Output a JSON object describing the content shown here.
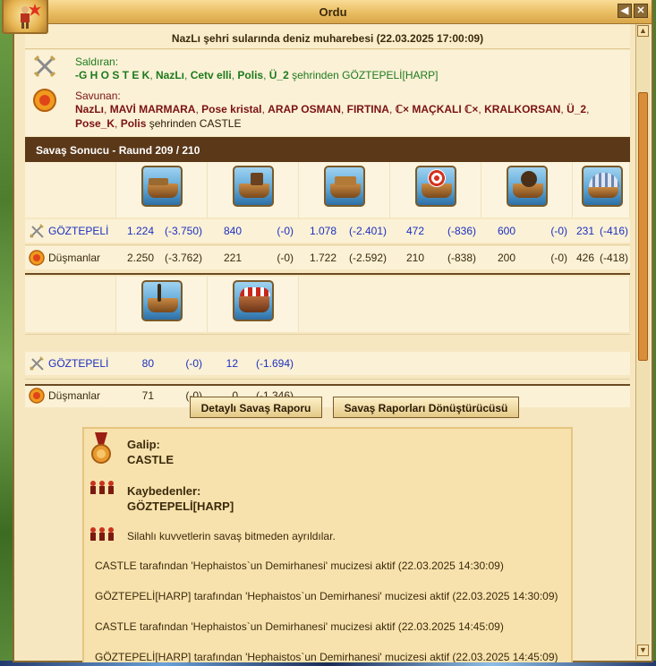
{
  "window": {
    "title": "Ordu"
  },
  "report": {
    "title": "NazLı şehri sularında deniz muharebesi (22.03.2025 17:00:09)"
  },
  "attacker": {
    "label": "Saldıran:",
    "names": [
      "-G H O S T E K",
      "NazLı",
      "Cetv elli",
      "Polis",
      "Ü_2"
    ],
    "from_text": "şehrinden GÖZTEPELİ[HARP]"
  },
  "defender": {
    "label": "Savunan:",
    "names": [
      "NazLı",
      "MAVİ MARMARA",
      "Pose kristal",
      "ARAP OSMAN",
      "FIRTINA",
      "ℂ× MAÇKALI ℂ×",
      "KRALKORSAN",
      "Ü_2",
      "Pose_K",
      "Polis"
    ],
    "from_text": "şehrinden CASTLE"
  },
  "result_bar": "Savaş Sonucu - Raund 209 / 210",
  "rows": {
    "ally_name": "GÖZTEPELİ",
    "enemy_name": "Düşmanlar"
  },
  "units_row1": [
    {
      "icon": "ram-ship-icon",
      "ally": "1.224",
      "ally_loss": "(-3.750)",
      "enemy": "2.250",
      "enemy_loss": "(-3.762)"
    },
    {
      "icon": "fire-ship-icon",
      "ally": "840",
      "ally_loss": "(-0)",
      "enemy": "221",
      "enemy_loss": "(-0)"
    },
    {
      "icon": "ballista-ship-icon",
      "ally": "1.078",
      "ally_loss": "(-2.401)",
      "enemy": "1.722",
      "enemy_loss": "(-2.592)"
    },
    {
      "icon": "catapult-ship-icon",
      "ally": "472",
      "ally_loss": "(-836)",
      "enemy": "210",
      "enemy_loss": "(-838)"
    },
    {
      "icon": "mortar-ship-icon",
      "ally": "600",
      "ally_loss": "(-0)",
      "enemy": "200",
      "enemy_loss": "(-0)"
    },
    {
      "icon": "paddle-speedboat-icon",
      "ally": "231",
      "ally_loss": "(-416)",
      "enemy": "426",
      "enemy_loss": "(-418)"
    }
  ],
  "units_row2": [
    {
      "icon": "rocket-ship-icon",
      "ally": "80",
      "ally_loss": "(-0)",
      "enemy": "71",
      "enemy_loss": "(-0)"
    },
    {
      "icon": "diving-boat-icon",
      "ally": "12",
      "ally_loss": "(-1.694)",
      "enemy": "0",
      "enemy_loss": "(-1.346)"
    }
  ],
  "buttons": {
    "detailed": "Detaylı Savaş Raporu",
    "converter": "Savaş Raporları Dönüştürücüsü"
  },
  "outcome": {
    "winner_label": "Galip:",
    "winner": "CASTLE",
    "losers_label": "Kaybedenler:",
    "losers": "GÖZTEPELİ[HARP]",
    "retreat_note": "Silahlı kuvvetlerin savaş bitmeden ayrıldılar.",
    "wonders": [
      "CASTLE tarafından 'Hephaistos`un Demirhanesi' mucizesi aktif (22.03.2025 14:30:09)",
      "GÖZTEPELİ[HARP] tarafından 'Hephaistos`un Demirhanesi' mucizesi aktif (22.03.2025 14:30:09)",
      "CASTLE tarafından 'Hephaistos`un Demirhanesi' mucizesi aktif (22.03.2025 14:45:09)",
      "GÖZTEPELİ[HARP] tarafından 'Hephaistos`un Demirhanesi' mucizesi aktif (22.03.2025 14:45:09)"
    ]
  }
}
